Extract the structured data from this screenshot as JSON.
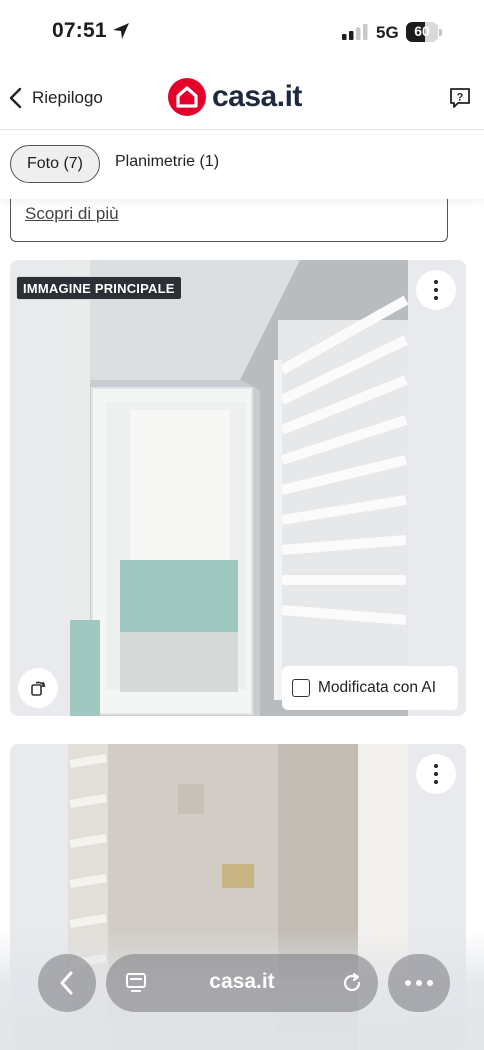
{
  "status_bar": {
    "time": "07:51",
    "network": "5G",
    "battery": "60",
    "battery_level": 0.6
  },
  "header": {
    "back_label": "Riepilogo",
    "logo_text": "casa.it",
    "brand_color": "#e4002b",
    "icons": [
      "chevron-left-icon",
      "casa-logo-icon",
      "help-question-icon"
    ]
  },
  "tabs": [
    {
      "label": "Foto (7)",
      "active": true
    },
    {
      "label": "Planimetrie (1)",
      "active": false
    }
  ],
  "info": {
    "link": "Scopri di più"
  },
  "photos": [
    {
      "badge": "IMMAGINE PRINCIPALE",
      "ai_label": "Modificata con AI",
      "ai_checked": false
    },
    {
      "badge": ""
    }
  ],
  "browser": {
    "url": "casa.it",
    "icons": [
      "back-icon",
      "tabs-icon",
      "reload-icon",
      "more-icon"
    ]
  }
}
